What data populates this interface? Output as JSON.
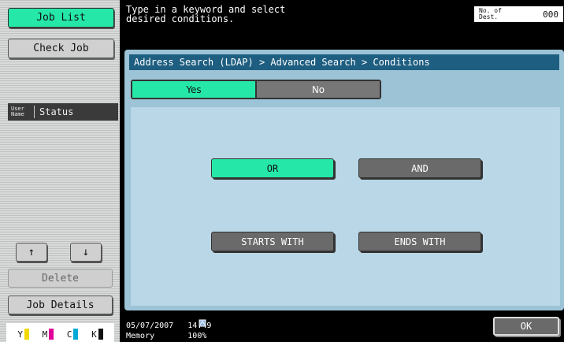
{
  "left_panel": {
    "job_list_label": "Job List",
    "check_job_label": "Check Job",
    "user_name_label": "User\nName",
    "status_label": "Status",
    "up_arrow": "↑",
    "down_arrow": "↓",
    "delete_label": "Delete",
    "job_details_label": "Job Details",
    "toners": [
      {
        "label": "Y",
        "color": "#f2d900"
      },
      {
        "label": "M",
        "color": "#e0009a"
      },
      {
        "label": "C",
        "color": "#00a8d8"
      },
      {
        "label": "K",
        "color": "#111111"
      }
    ]
  },
  "top_bar": {
    "message": "Type in a keyword and select\ndesired conditions.",
    "dest_label": "No. of\nDest.",
    "dest_value": "000"
  },
  "main": {
    "breadcrumb": "Address Search (LDAP) > Advanced Search > Conditions",
    "tabs": [
      {
        "label": "Yes",
        "selected": true
      },
      {
        "label": "No",
        "selected": false
      }
    ],
    "options": {
      "or": "OR",
      "and": "AND",
      "starts_with": "STARTS WITH",
      "ends_with": "ENDS WITH"
    }
  },
  "bottom_bar": {
    "date": "05/07/2007",
    "time": "14:49",
    "memory_label": "Memory",
    "memory_value": "100%",
    "ok_label": "OK"
  },
  "colors": {
    "accent": "#25e8a8",
    "breadcrumb_bg": "#1e5e80",
    "panel_bg": "#9cc3d6"
  }
}
